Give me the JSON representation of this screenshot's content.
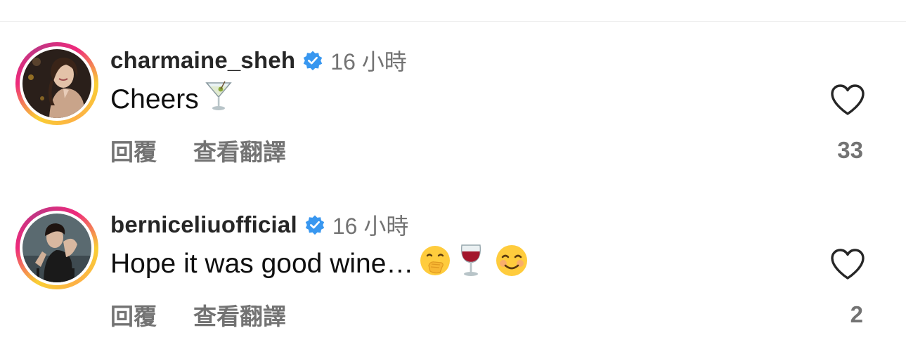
{
  "comments": [
    {
      "username": "charmaine_sheh",
      "verified": true,
      "time": "16 小時",
      "text": "Cheers",
      "emojis": [
        "martini-emoji"
      ],
      "reply_label": "回覆",
      "translate_label": "查看翻譯",
      "like_count": "33"
    },
    {
      "username": "berniceliuofficial",
      "verified": true,
      "time": "16 小時",
      "text": "Hope it was good wine…",
      "emojis": [
        "face-with-hand-over-mouth-emoji",
        "wine-glass-emoji",
        "smiling-face-emoji"
      ],
      "reply_label": "回覆",
      "translate_label": "查看翻譯",
      "like_count": "2"
    }
  ],
  "colors": {
    "verified_badge": "#3897f0",
    "secondary_text": "#737373",
    "primary_text": "#262626",
    "ring_start": "#f9ce34",
    "ring_mid": "#ee2a7b",
    "ring_end": "#c13584"
  }
}
